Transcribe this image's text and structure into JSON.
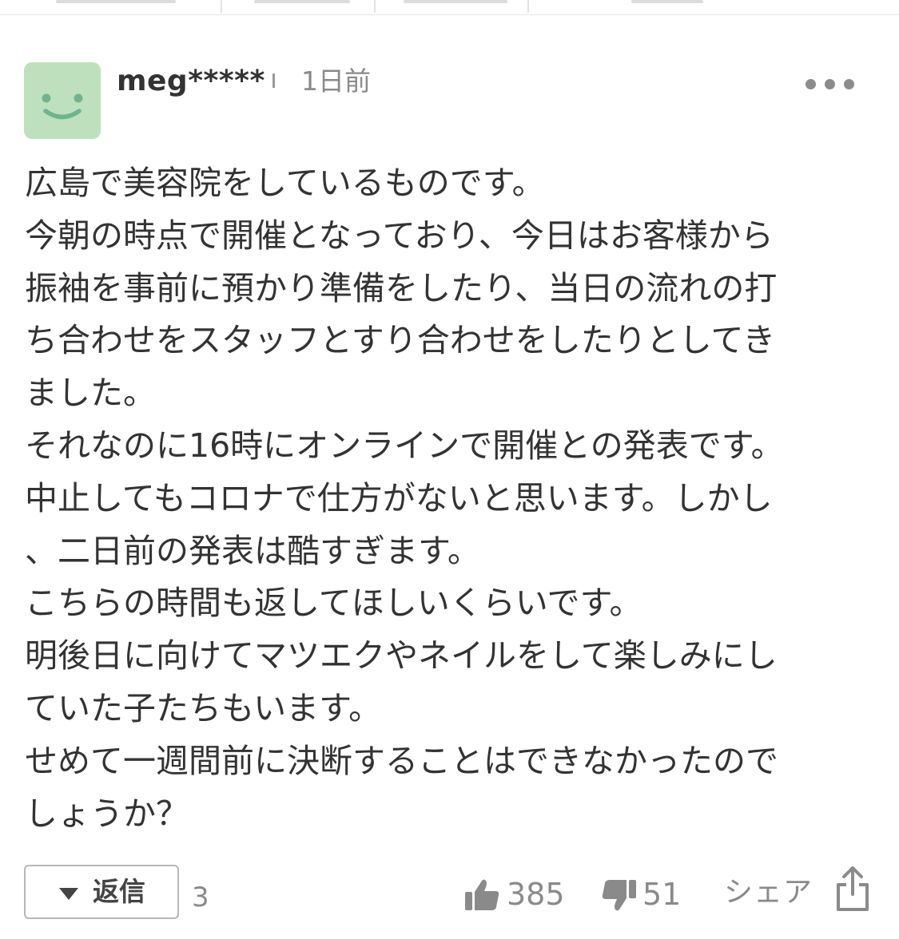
{
  "comment": {
    "username": "meg*****",
    "timestamp": "1日前",
    "body_lines": [
      "広島で美容院をしているものです。",
      "今朝の時点で開催となっており、今日はお客様から",
      "振袖を事前に預かり準備をしたり、当日の流れの打",
      "ち合わせをスタッフとすり合わせをしたりとしてき",
      "ました。",
      "それなのに16時にオンラインで開催との発表です。",
      "中止してもコロナで仕方がないと思います。しかし",
      "、二日前の発表は酷すぎます。",
      "こちらの時間も返してほしいくらいです。",
      "明後日に向けてマツエクやネイルをして楽しみにし",
      "ていた子たちもいます。",
      "せめて一週間前に決断することはできなかったので",
      "しょうか？"
    ]
  },
  "actions": {
    "reply_label": "返信",
    "reply_count": "3",
    "like_count": "385",
    "dislike_count": "51",
    "share_label": "シェア"
  },
  "icons": {
    "avatar": "smiley-face-icon",
    "more": "more-dots-icon",
    "reply": "triangle-down-icon",
    "like": "thumbs-up-icon",
    "dislike": "thumbs-down-icon",
    "share": "share-icon"
  },
  "colors": {
    "avatar_bg": "#bfe0bc",
    "avatar_face": "#6fb48f",
    "text": "#333333",
    "muted": "#8a8a8a"
  }
}
